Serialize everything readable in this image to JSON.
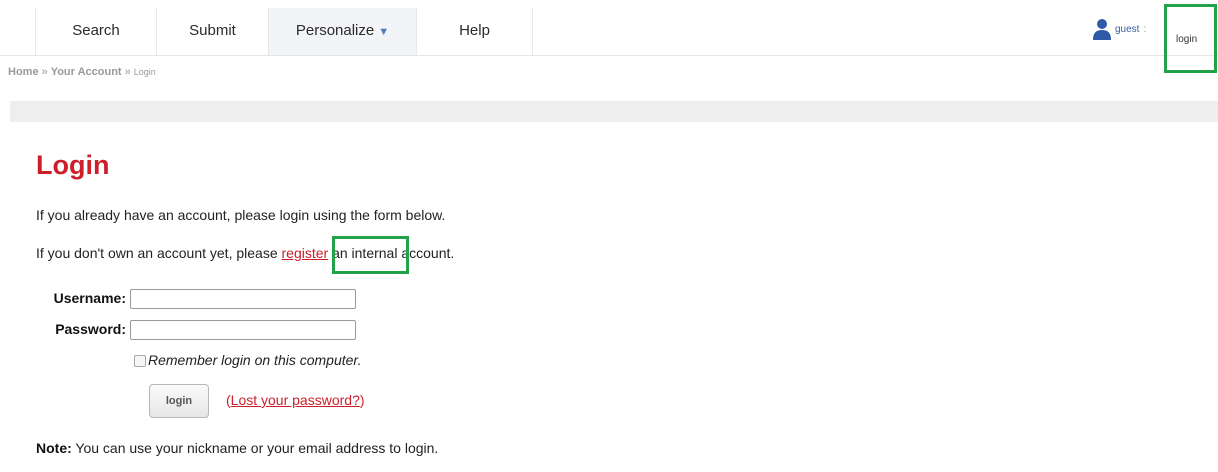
{
  "nav": {
    "tabs": [
      {
        "label": "Search"
      },
      {
        "label": "Submit"
      },
      {
        "label": "Personalize",
        "has_dropdown": true,
        "active": true
      },
      {
        "label": "Help"
      }
    ],
    "user_name": "guest",
    "user_separator": ":",
    "login_link": "login"
  },
  "breadcrumb": {
    "items": [
      "Home",
      "Your Account"
    ],
    "separator": "»",
    "current": "Login"
  },
  "main": {
    "title": "Login",
    "intro": "If you already have an account, please login using the form below.",
    "register_prefix": "If you don't own an account yet, please ",
    "register_link": "register",
    "register_suffix": " an internal account.",
    "form": {
      "username_label": "Username:",
      "username_value": "",
      "password_label": "Password:",
      "password_value": "",
      "remember_label": "Remember login on this computer.",
      "remember_checked": false,
      "submit_label": "login",
      "lost_open": "(",
      "lost_link": "Lost your password?",
      "lost_close": ")"
    },
    "note_label": "Note:",
    "note_text": " You can use your nickname or your email address to login."
  },
  "colors": {
    "accent_red": "#cc1f2a",
    "highlight_green": "#22a34a",
    "user_blue": "#2f5aa8"
  },
  "icons": {
    "user": "user-silhouette-icon",
    "dropdown": "caret-down-icon"
  }
}
